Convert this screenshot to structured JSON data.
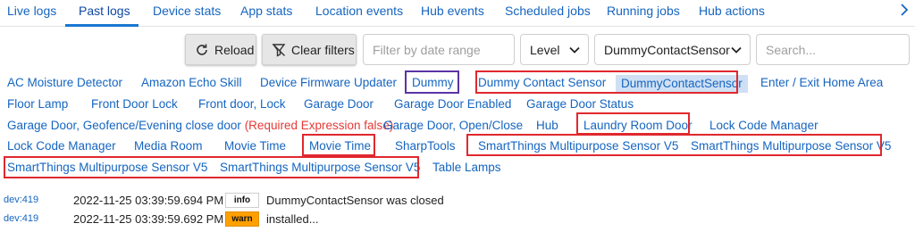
{
  "tabs": [
    {
      "label": "Live logs",
      "active": false
    },
    {
      "label": "Past logs",
      "active": true
    },
    {
      "label": "Device stats",
      "active": false
    },
    {
      "label": "App stats",
      "active": false
    },
    {
      "label": "Location events",
      "active": false
    },
    {
      "label": "Hub events",
      "active": false
    },
    {
      "label": "Scheduled jobs",
      "active": false
    },
    {
      "label": "Running jobs",
      "active": false
    },
    {
      "label": "Hub actions",
      "active": false
    }
  ],
  "tab_scroll_icon": "chevron-right-icon",
  "toolbar": {
    "reload_label": "Reload",
    "clear_filters_label": "Clear filters",
    "date_range_placeholder": "Filter by date range",
    "level_label": "Level",
    "device_select_value": "DummyContactSensor",
    "search_placeholder": "Search..."
  },
  "devices": [
    {
      "label": "AC Moisture Detector"
    },
    {
      "label": "Amazon Echo Skill"
    },
    {
      "label": "Device Firmware Updater"
    },
    {
      "label": "Dummy",
      "highlight": "purple"
    },
    {
      "label": "Dummy Contact Sensor",
      "highlight": "red"
    },
    {
      "label": "DummyContactSensor",
      "highlight": "red",
      "selected": true
    },
    {
      "label": "Enter / Exit Home Area"
    },
    {
      "label": "Floor Lamp"
    },
    {
      "label": "Front Door Lock"
    },
    {
      "label": "Front door, Lock"
    },
    {
      "label": "Garage Door"
    },
    {
      "label": "Garage Door Enabled"
    },
    {
      "label": "Garage Door Status"
    },
    {
      "label": "Garage Door, Geofence/Evening close door",
      "suffix": "(Required Expression false)"
    },
    {
      "label": "Garage Door, Open/Close"
    },
    {
      "label": "Hub"
    },
    {
      "label": "Laundry Room Door",
      "highlight": "red"
    },
    {
      "label": "Lock Code Manager"
    },
    {
      "label": "Lock Code Manager"
    },
    {
      "label": "Media Room"
    },
    {
      "label": "Movie Time"
    },
    {
      "label": "Movie Time",
      "highlight": "red"
    },
    {
      "label": "SharpTools"
    },
    {
      "label": "SmartThings Multipurpose Sensor V5",
      "highlight": "red"
    },
    {
      "label": "SmartThings Multipurpose Sensor V5",
      "highlight": "red"
    },
    {
      "label": "SmartThings Multipurpose Sensor V5",
      "highlight": "red"
    },
    {
      "label": "SmartThings Multipurpose Sensor V5",
      "highlight": "red"
    },
    {
      "label": "Table Lamps"
    }
  ],
  "logs": [
    {
      "source": "dev:419",
      "time": "2022-11-25 03:39:59.694 PM",
      "level": "info",
      "message": "DummyContactSensor was closed"
    },
    {
      "source": "dev:419",
      "time": "2022-11-25 03:39:59.692 PM",
      "level": "warn",
      "message": "installed..."
    }
  ],
  "colors": {
    "link": "#1565c0",
    "error_text": "#e53935",
    "highlight_red": "#e0282e",
    "highlight_purple": "#5a34a6",
    "selected_bg": "#cfe0f4",
    "warn_bg": "#ffa000"
  }
}
